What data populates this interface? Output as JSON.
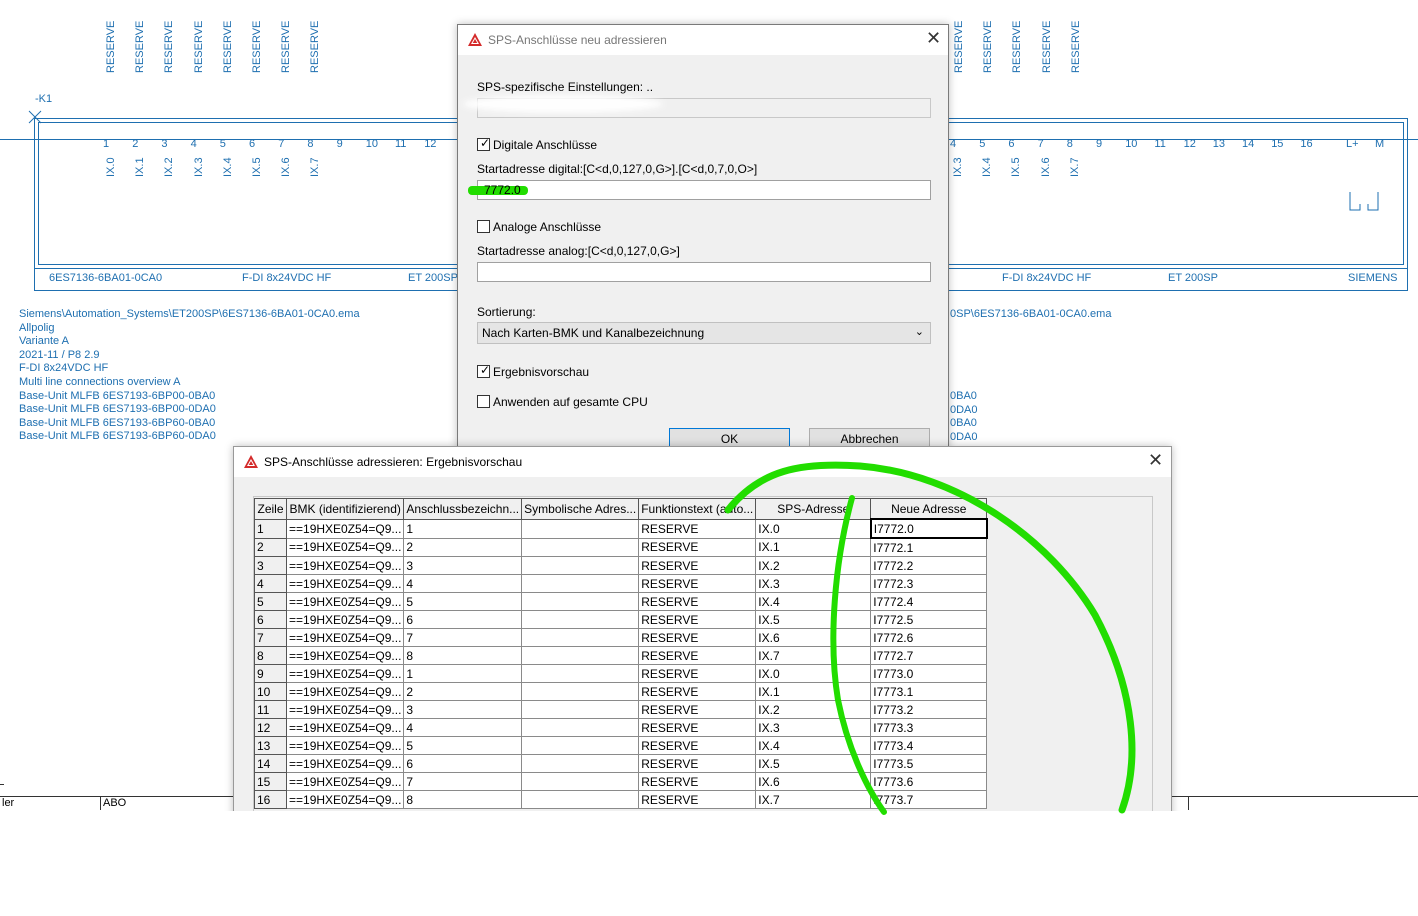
{
  "schematic": {
    "device_tag": "-K1",
    "reserve_label": "RESERVE",
    "reserve_count_left": 8,
    "reserve_count_right": 5,
    "pins_left": [
      "1",
      "2",
      "3",
      "4",
      "5",
      "6",
      "7",
      "8",
      "9",
      "10",
      "11",
      "12"
    ],
    "pin_channels_left": [
      "IX.0",
      "IX.1",
      "IX.2",
      "IX.3",
      "IX.4",
      "IX.5",
      "IX.6",
      "IX.7"
    ],
    "pins_right": [
      "4",
      "5",
      "6",
      "7",
      "8",
      "9",
      "10",
      "11",
      "12",
      "13",
      "14",
      "15",
      "16",
      "L+",
      "M"
    ],
    "pin_channels_right": [
      "IX.3",
      "IX.4",
      "IX.5",
      "IX.6",
      "IX.7"
    ],
    "bottom_left": [
      "6ES7136-6BA01-0CA0",
      "F-DI 8x24VDC HF",
      "ET 200SP"
    ],
    "bottom_right": [
      "F-DI 8x24VDC HF",
      "ET 200SP",
      "SIEMENS"
    ],
    "info_lines": [
      "Siemens\\Automation_Systems\\ET200SP\\6ES7136-6BA01-0CA0.ema",
      "Allpolig",
      "Variante A",
      "2021-11 / P8 2.9",
      "F-DI 8x24VDC HF",
      "Multi line connections overview A",
      "Base-Unit MLFB 6ES7193-6BP00-0BA0",
      "Base-Unit MLFB 6ES7193-6BP00-0DA0",
      "Base-Unit MLFB 6ES7193-6BP60-0BA0",
      "Base-Unit MLFB 6ES7193-6BP60-0DA0"
    ],
    "info_right_first": "0SP\\6ES7136-6BA01-0CA0.ema",
    "info_right_tail": [
      "0BA0",
      "0DA0",
      "0BA0",
      "0DA0"
    ],
    "footer_left": "ler",
    "footer_abo": "ABO"
  },
  "dialog1": {
    "title": "SPS-Anschlüsse neu adressieren",
    "sps_settings_label": "SPS-spezifische Einstellungen: ..",
    "sps_settings_value": "",
    "digital_checkbox_label": "Digitale Anschlüsse",
    "digital_checked": true,
    "start_digital_label": "Startadresse digital:[C<d,0,127,0,G>].[C<d,0,7,0,O>]",
    "start_digital_value": "7772.0",
    "analog_checkbox_label": "Analoge Anschlüsse",
    "analog_checked": false,
    "start_analog_label": "Startadresse analog:[C<d,0,127,0,G>]",
    "start_analog_value": "",
    "sort_label": "Sortierung:",
    "sort_value": "Nach Karten-BMK und Kanalbezeichnung",
    "preview_label": "Ergebnisvorschau",
    "preview_checked": true,
    "apply_cpu_label": "Anwenden auf gesamte CPU",
    "apply_cpu_checked": false,
    "ok_label": "OK",
    "cancel_label": "Abbrechen"
  },
  "dialog2": {
    "title": "SPS-Anschlüsse adressieren: Ergebnisvorschau",
    "columns": [
      "Zeile",
      "BMK (identifizierend)",
      "Anschlussbezeichn...",
      "Symbolische Adres...",
      "Funktionstext (auto...",
      "SPS-Adresse",
      "Neue Adresse"
    ],
    "rows": [
      [
        "1",
        "==19HXE0Z54=Q9...",
        "1",
        "",
        "RESERVE",
        "IX.0",
        "I7772.0"
      ],
      [
        "2",
        "==19HXE0Z54=Q9...",
        "2",
        "",
        "RESERVE",
        "IX.1",
        "I7772.1"
      ],
      [
        "3",
        "==19HXE0Z54=Q9...",
        "3",
        "",
        "RESERVE",
        "IX.2",
        "I7772.2"
      ],
      [
        "4",
        "==19HXE0Z54=Q9...",
        "4",
        "",
        "RESERVE",
        "IX.3",
        "I7772.3"
      ],
      [
        "5",
        "==19HXE0Z54=Q9...",
        "5",
        "",
        "RESERVE",
        "IX.4",
        "I7772.4"
      ],
      [
        "6",
        "==19HXE0Z54=Q9...",
        "6",
        "",
        "RESERVE",
        "IX.5",
        "I7772.5"
      ],
      [
        "7",
        "==19HXE0Z54=Q9...",
        "7",
        "",
        "RESERVE",
        "IX.6",
        "I7772.6"
      ],
      [
        "8",
        "==19HXE0Z54=Q9...",
        "8",
        "",
        "RESERVE",
        "IX.7",
        "I7772.7"
      ],
      [
        "9",
        "==19HXE0Z54=Q9...",
        "1",
        "",
        "RESERVE",
        "IX.0",
        "I7773.0"
      ],
      [
        "10",
        "==19HXE0Z54=Q9...",
        "2",
        "",
        "RESERVE",
        "IX.1",
        "I7773.1"
      ],
      [
        "11",
        "==19HXE0Z54=Q9...",
        "3",
        "",
        "RESERVE",
        "IX.2",
        "I7773.2"
      ],
      [
        "12",
        "==19HXE0Z54=Q9...",
        "4",
        "",
        "RESERVE",
        "IX.3",
        "I7773.3"
      ],
      [
        "13",
        "==19HXE0Z54=Q9...",
        "5",
        "",
        "RESERVE",
        "IX.4",
        "I7773.4"
      ],
      [
        "14",
        "==19HXE0Z54=Q9...",
        "6",
        "",
        "RESERVE",
        "IX.5",
        "I7773.5"
      ],
      [
        "15",
        "==19HXE0Z54=Q9...",
        "7",
        "",
        "RESERVE",
        "IX.6",
        "I7773.6"
      ],
      [
        "16",
        "==19HXE0Z54=Q9...",
        "8",
        "",
        "RESERVE",
        "IX.7",
        "I7773.7"
      ]
    ]
  },
  "colors": {
    "schematic_blue": "#1e6fb0",
    "highlight_green": "#22dd00",
    "app_icon_red": "#d42a2a"
  }
}
